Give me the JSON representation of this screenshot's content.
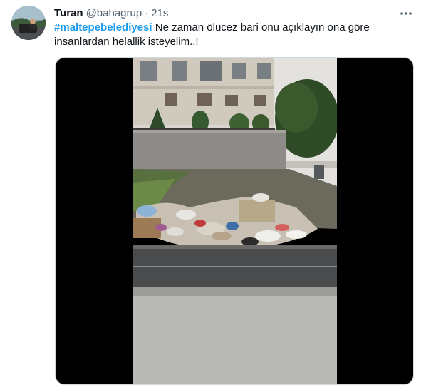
{
  "tweet": {
    "author_name": "Turan",
    "author_handle": "@bahagrup",
    "separator": "·",
    "time": "21s",
    "hashtag": "#maltepebelediyesi",
    "body_text": " Ne zaman ölücez bari onu açıklayın ona göre insanlardan helallik isteyelim..!"
  },
  "icons": {
    "more": "more-horizontal-icon"
  },
  "colors": {
    "link": "#1d9bf0",
    "secondary_text": "#536471",
    "primary_text": "#0f1419"
  }
}
